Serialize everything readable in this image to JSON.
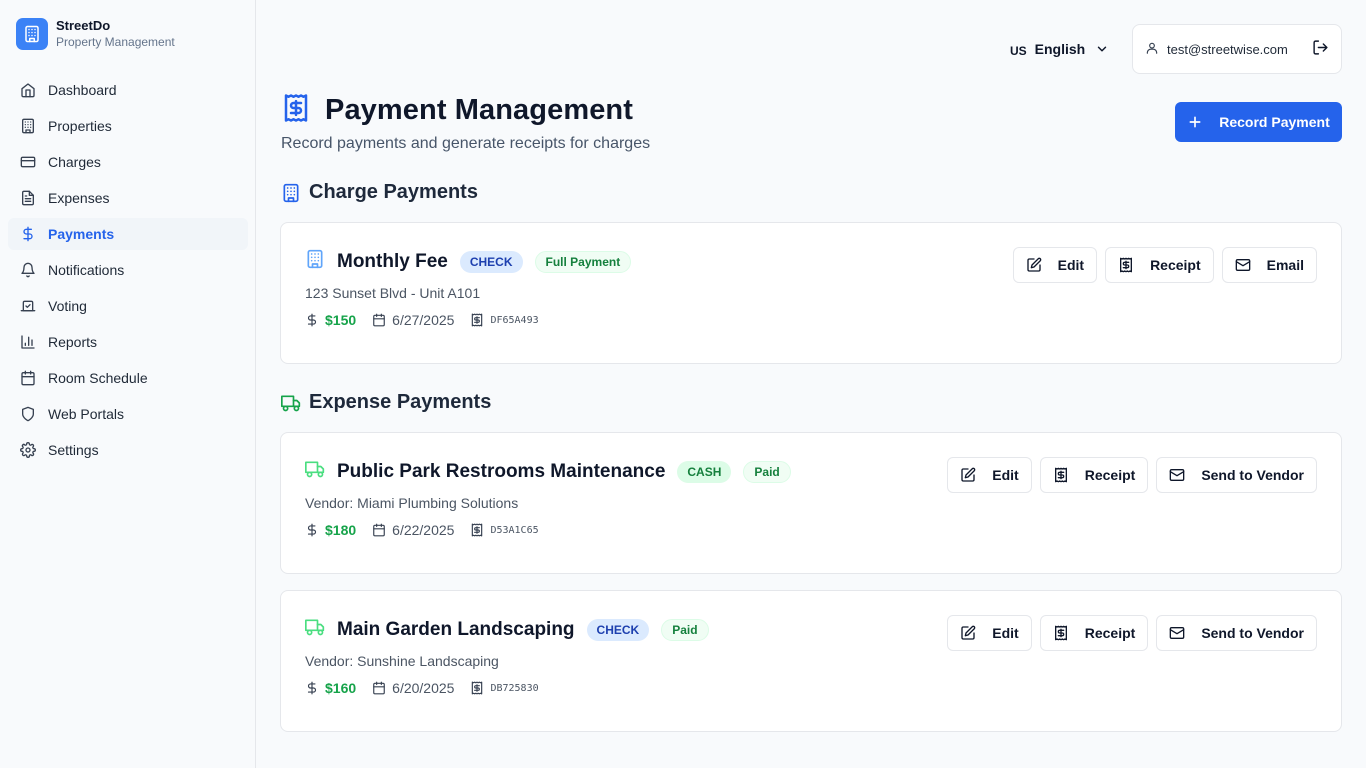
{
  "brand": {
    "name": "StreetDo",
    "subtitle": "Property Management"
  },
  "nav": [
    {
      "label": "Dashboard",
      "icon": "home-icon"
    },
    {
      "label": "Properties",
      "icon": "building-icon"
    },
    {
      "label": "Charges",
      "icon": "credit-card-icon"
    },
    {
      "label": "Expenses",
      "icon": "file-text-icon"
    },
    {
      "label": "Payments",
      "icon": "dollar-icon",
      "active": true
    },
    {
      "label": "Notifications",
      "icon": "bell-icon"
    },
    {
      "label": "Voting",
      "icon": "vote-icon"
    },
    {
      "label": "Reports",
      "icon": "bar-chart-icon"
    },
    {
      "label": "Room Schedule",
      "icon": "calendar-icon"
    },
    {
      "label": "Web Portals",
      "icon": "shield-icon"
    },
    {
      "label": "Settings",
      "icon": "gear-icon"
    }
  ],
  "topbar": {
    "lang_code": "US",
    "lang_name": "English",
    "user_email": "test@streetwise.com"
  },
  "header": {
    "title": "Payment Management",
    "subtitle": "Record payments and generate receipts for charges",
    "record_button": "Record Payment"
  },
  "sections": {
    "charge": "Charge Payments",
    "expense": "Expense Payments"
  },
  "charge_payments": [
    {
      "title": "Monthly Fee",
      "method": "CHECK",
      "status": "Full Payment",
      "subtitle": "123 Sunset Blvd - Unit A101",
      "amount": "$150",
      "date": "6/27/2025",
      "ref": "DF65A493",
      "actions": [
        "Edit",
        "Receipt",
        "Email"
      ]
    }
  ],
  "expense_payments": [
    {
      "title": "Public Park Restrooms Maintenance",
      "method": "CASH",
      "status": "Paid",
      "subtitle": "Vendor: Miami Plumbing Solutions",
      "amount": "$180",
      "date": "6/22/2025",
      "ref": "D53A1C65",
      "actions": [
        "Edit",
        "Receipt",
        "Send to Vendor"
      ]
    },
    {
      "title": "Main Garden Landscaping",
      "method": "CHECK",
      "status": "Paid",
      "subtitle": "Vendor: Sunshine Landscaping",
      "amount": "$160",
      "date": "6/20/2025",
      "ref": "DB725830",
      "actions": [
        "Edit",
        "Receipt",
        "Send to Vendor"
      ]
    }
  ],
  "colors": {
    "primary": "#2563eb",
    "success": "#16a34a",
    "badge_blue": "#dbeafe",
    "badge_green": "#dcfce7"
  }
}
